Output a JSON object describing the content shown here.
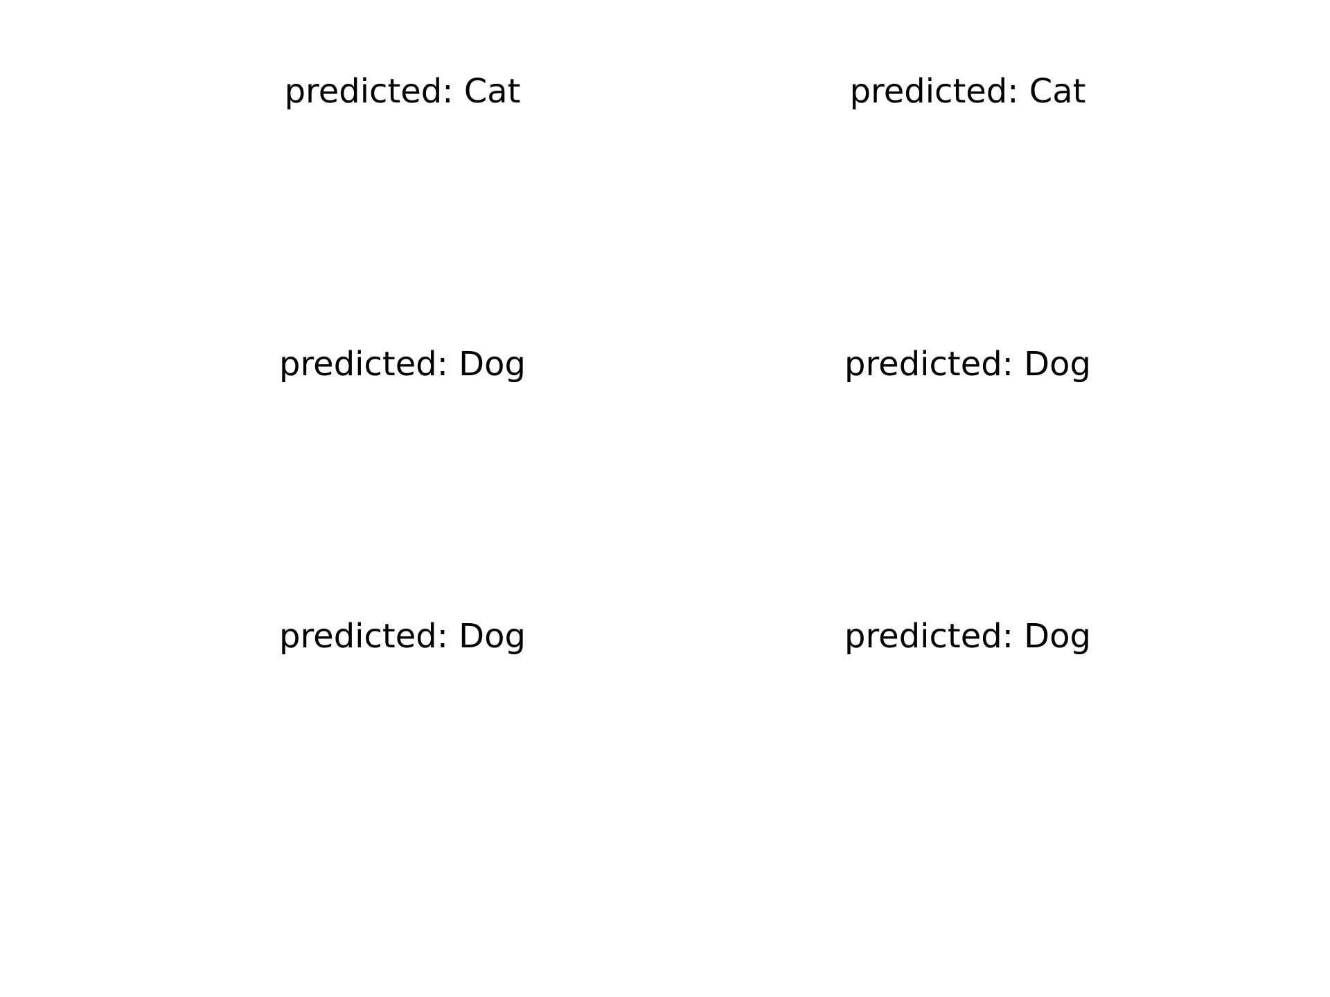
{
  "panels": [
    {
      "title": "predicted: Cat"
    },
    {
      "title": "predicted: Cat"
    },
    {
      "title": "predicted: Dog"
    },
    {
      "title": "predicted: Dog"
    },
    {
      "title": "predicted: Dog"
    },
    {
      "title": "predicted: Dog"
    }
  ]
}
